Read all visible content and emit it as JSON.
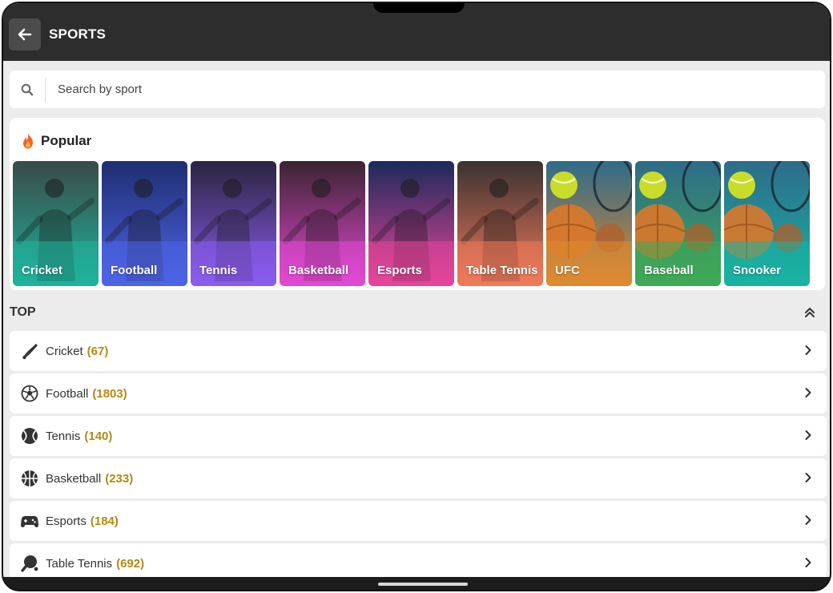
{
  "header": {
    "title": "SPORTS"
  },
  "search": {
    "placeholder": "Search by sport"
  },
  "popular": {
    "title": "Popular",
    "cards": [
      {
        "label": "Cricket",
        "top": "#3a4a48",
        "bottom": "#1fb39c"
      },
      {
        "label": "Football",
        "top": "#1f2e70",
        "bottom": "#4e64e8"
      },
      {
        "label": "Tennis",
        "top": "#2a2540",
        "bottom": "#8b5cf0"
      },
      {
        "label": "Basketball",
        "top": "#3a2430",
        "bottom": "#e349d4"
      },
      {
        "label": "Esports",
        "top": "#1b2a5a",
        "bottom": "#e8459a"
      },
      {
        "label": "Table Tennis",
        "top": "#3a3232",
        "bottom": "#f07a5a"
      },
      {
        "label": "UFC",
        "top": "#2e6b8a",
        "bottom": "#e08a30"
      },
      {
        "label": "Baseball",
        "top": "#2e6b8a",
        "bottom": "#3faa55"
      },
      {
        "label": "Snooker",
        "top": "#2e6b8a",
        "bottom": "#19b3a3"
      }
    ]
  },
  "top": {
    "title": "TOP",
    "items": [
      {
        "name": "Cricket",
        "count": "(67)",
        "icon": "cricket-bat-icon"
      },
      {
        "name": "Football",
        "count": "(1803)",
        "icon": "soccer-ball-icon"
      },
      {
        "name": "Tennis",
        "count": "(140)",
        "icon": "tennis-ball-icon"
      },
      {
        "name": "Basketball",
        "count": "(233)",
        "icon": "basketball-icon"
      },
      {
        "name": "Esports",
        "count": "(184)",
        "icon": "gamepad-icon"
      },
      {
        "name": "Table Tennis",
        "count": "(692)",
        "icon": "ping-pong-paddle-icon"
      }
    ]
  },
  "colors": {
    "accent_count": "#b38a14",
    "header_bg": "#2d2d2d",
    "page_bg": "#ececec"
  }
}
